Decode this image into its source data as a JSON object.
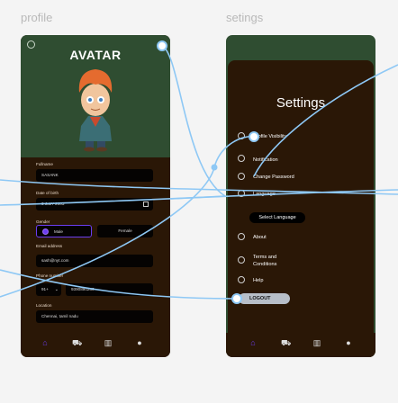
{
  "frames": {
    "profile_label": "profile",
    "settings_label": "setings"
  },
  "profile": {
    "avatar_title": "AVATAR",
    "fullname": {
      "label": "Fullname",
      "value": "SASANK"
    },
    "dob": {
      "label": "Date of birth",
      "value": "3 JuLY 2003"
    },
    "gender": {
      "label": "Gender",
      "male": "Male",
      "female": "Female"
    },
    "email": {
      "label": "Email address",
      "value": "sash@nyt.com"
    },
    "phone": {
      "label": "Phone number",
      "code": "91+",
      "value": "9390890280"
    },
    "location": {
      "label": "Location",
      "value": "Chennai, tamil nadu"
    }
  },
  "settings": {
    "title": "Settings",
    "items": [
      "Profile Visibility",
      "Notification",
      "Change Password",
      "Language"
    ],
    "select_language": "Select Language",
    "about": "About",
    "terms": [
      "Terms and",
      "Conditions"
    ],
    "help": "Help",
    "logout": "LOGOUT"
  },
  "colors": {
    "green": "#2f4d31",
    "brown": "#2a1706",
    "accent": "#6b3df0",
    "wire": "#8ec8f5"
  },
  "icons": [
    "home-icon",
    "cart-icon",
    "stats-icon",
    "user-icon"
  ]
}
